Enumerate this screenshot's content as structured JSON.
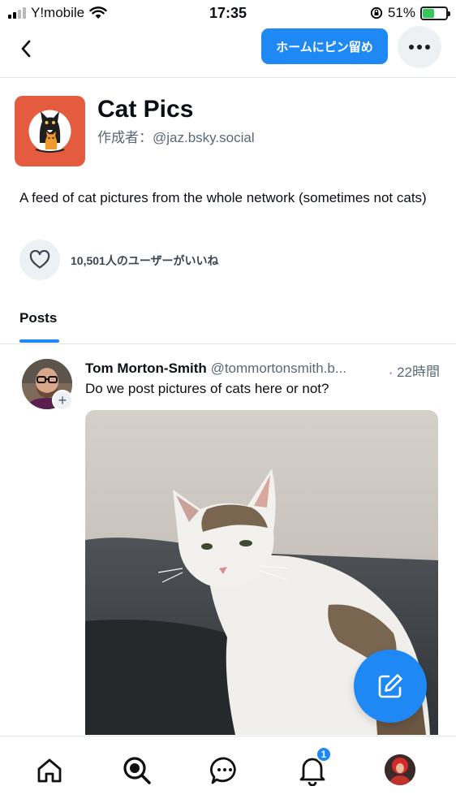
{
  "status_bar": {
    "carrier": "Y!mobile",
    "time": "17:35",
    "battery_percent": "51%",
    "battery_level": 0.51,
    "icons": [
      "signal-icon",
      "wifi-icon",
      "rotation-lock-icon",
      "battery-charging-icon"
    ]
  },
  "header": {
    "back_icon": "chevron-left-icon",
    "pin_label": "ホームにピン留め",
    "more_icon": "ellipsis-icon"
  },
  "feed": {
    "title": "Cat Pics",
    "author": "作成者：@jaz.bsky.social",
    "description": "A feed of cat pictures from the whole network (sometimes not cats)",
    "like_icon": "heart-icon",
    "like_count_label": "10,501人のユーザーがいいね"
  },
  "tabs": [
    {
      "label": "Posts",
      "active": true
    }
  ],
  "post": {
    "author_name": "Tom Morton-Smith",
    "author_handle": "@tommortonsmith.b...",
    "time": "· 22時間",
    "text": "Do we post pictures of cats here or not?",
    "follow_icon": "plus-icon"
  },
  "compose": {
    "icon": "compose-icon"
  },
  "bottom_nav": {
    "items": [
      "home-icon",
      "search-icon",
      "chat-icon",
      "bell-icon",
      "profile-avatar"
    ],
    "notification_count": "1"
  },
  "colors": {
    "accent": "#1e88f5",
    "feed_avatar_bg": "#e55b3f",
    "muted_text": "#5b6876"
  }
}
